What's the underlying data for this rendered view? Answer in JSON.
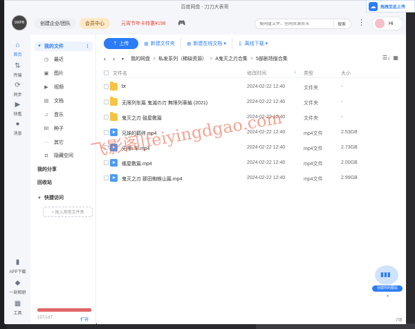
{
  "window": {
    "title": "百度网盘 - 刀刀大表哥"
  },
  "header": {
    "logo_text": "SWPB",
    "team_label": "创建企业/团队",
    "member_label": "会员中心",
    "promo_label": "元宵节年卡特惠¥198",
    "search_placeholder": "搜网盘文件、全网资源资讯",
    "search_button": "搜索",
    "user_greeting": "Hi"
  },
  "float_upload": {
    "label": "拖拽至此上传"
  },
  "rail": {
    "items": [
      {
        "label": "首页"
      },
      {
        "label": "传输"
      },
      {
        "label": "同步"
      },
      {
        "label": "快看"
      },
      {
        "label": "消息"
      }
    ],
    "bottom": [
      {
        "label": "APP下载"
      },
      {
        "label": "一刻相册"
      },
      {
        "label": "工具"
      }
    ]
  },
  "sidebar": {
    "my_files": "我的文件",
    "categories": [
      {
        "label": "最近",
        "icon": "clock-icon"
      },
      {
        "label": "图片",
        "icon": "image-icon"
      },
      {
        "label": "视频",
        "icon": "video-icon"
      },
      {
        "label": "文档",
        "icon": "document-icon"
      },
      {
        "label": "音乐",
        "icon": "music-icon"
      },
      {
        "label": "种子",
        "icon": "torrent-icon"
      },
      {
        "label": "其它",
        "icon": "more-icon"
      },
      {
        "label": "隐藏空间",
        "icon": "lock-icon"
      }
    ],
    "share": "我的分享",
    "recycle": "回收站",
    "quick_access": "快捷访问",
    "drop_hint": "+ 拖入常用文件夹",
    "storage": "15T/16T",
    "expand": "扩容"
  },
  "toolbar": {
    "upload": "上传",
    "new_folder": "新建文件夹",
    "new_doc": "新建在线文档",
    "offline": "离线下载"
  },
  "breadcrumb": [
    "我的网盘",
    "私发系列（稀缺资源）",
    "A鬼灭之刃合集",
    "5部剧场版合集"
  ],
  "columns": {
    "name": "文件名",
    "modified": "修改时间",
    "type": "类型",
    "size": "大小"
  },
  "files": [
    {
      "name": "bt",
      "modified": "2024-02-22 12:40",
      "type": "文件夹",
      "size": "-",
      "kind": "folder"
    },
    {
      "name": "无限列车篇 鬼滅の刃 無限列車編 (2021)",
      "modified": "2024-02-22 12:40",
      "type": "文件夹",
      "size": "-",
      "kind": "folder"
    },
    {
      "name": "鬼灭之刃 鼓屋敷篇",
      "modified": "2024-02-22 12:40",
      "type": "文件夹",
      "size": "-",
      "kind": "folder"
    },
    {
      "name": "兄妹的羁绊.mp4",
      "modified": "2024-02-22 12:40",
      "type": "mp4文件",
      "size": "2.53GB",
      "kind": "video"
    },
    {
      "name": "无限L车.mp4",
      "modified": "2024-02-22 12:40",
      "type": "mp4文件",
      "size": "2.73GB",
      "kind": "video"
    },
    {
      "name": "蝶屋敷篇.mp4",
      "modified": "2024-02-22 12:40",
      "type": "mp4文件",
      "size": "2.00GB",
      "kind": "video"
    },
    {
      "name": "鬼灭之刃 那田蜘蛛山篇.mp4",
      "modified": "2024-02-22 12:40",
      "type": "mp4文件",
      "size": "2.99GB",
      "kind": "video"
    }
  ],
  "watermark": "飞影阁|feiyingdgao.com",
  "float_promo": {
    "label": "创建你的图站"
  },
  "item_count": "7项",
  "colors": {
    "accent": "#2b7cf6",
    "folder": "#f6c343",
    "video": "#4c9bf5",
    "storage": "#e06666"
  }
}
